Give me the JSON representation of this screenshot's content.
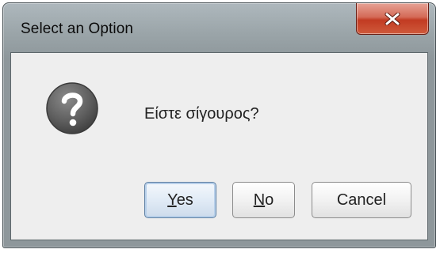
{
  "dialog": {
    "title": "Select an Option",
    "close_label": "x",
    "message": "Είστε σίγουρος?",
    "icon": "question-icon"
  },
  "buttons": {
    "yes": {
      "mnemonic": "Y",
      "rest": "es"
    },
    "no": {
      "mnemonic": "N",
      "rest": "o"
    },
    "cancel": {
      "label": "Cancel"
    }
  },
  "colors": {
    "close_button": "#c8432b",
    "client_background": "#eeeeee",
    "default_button_border": "#5d7fa3"
  }
}
